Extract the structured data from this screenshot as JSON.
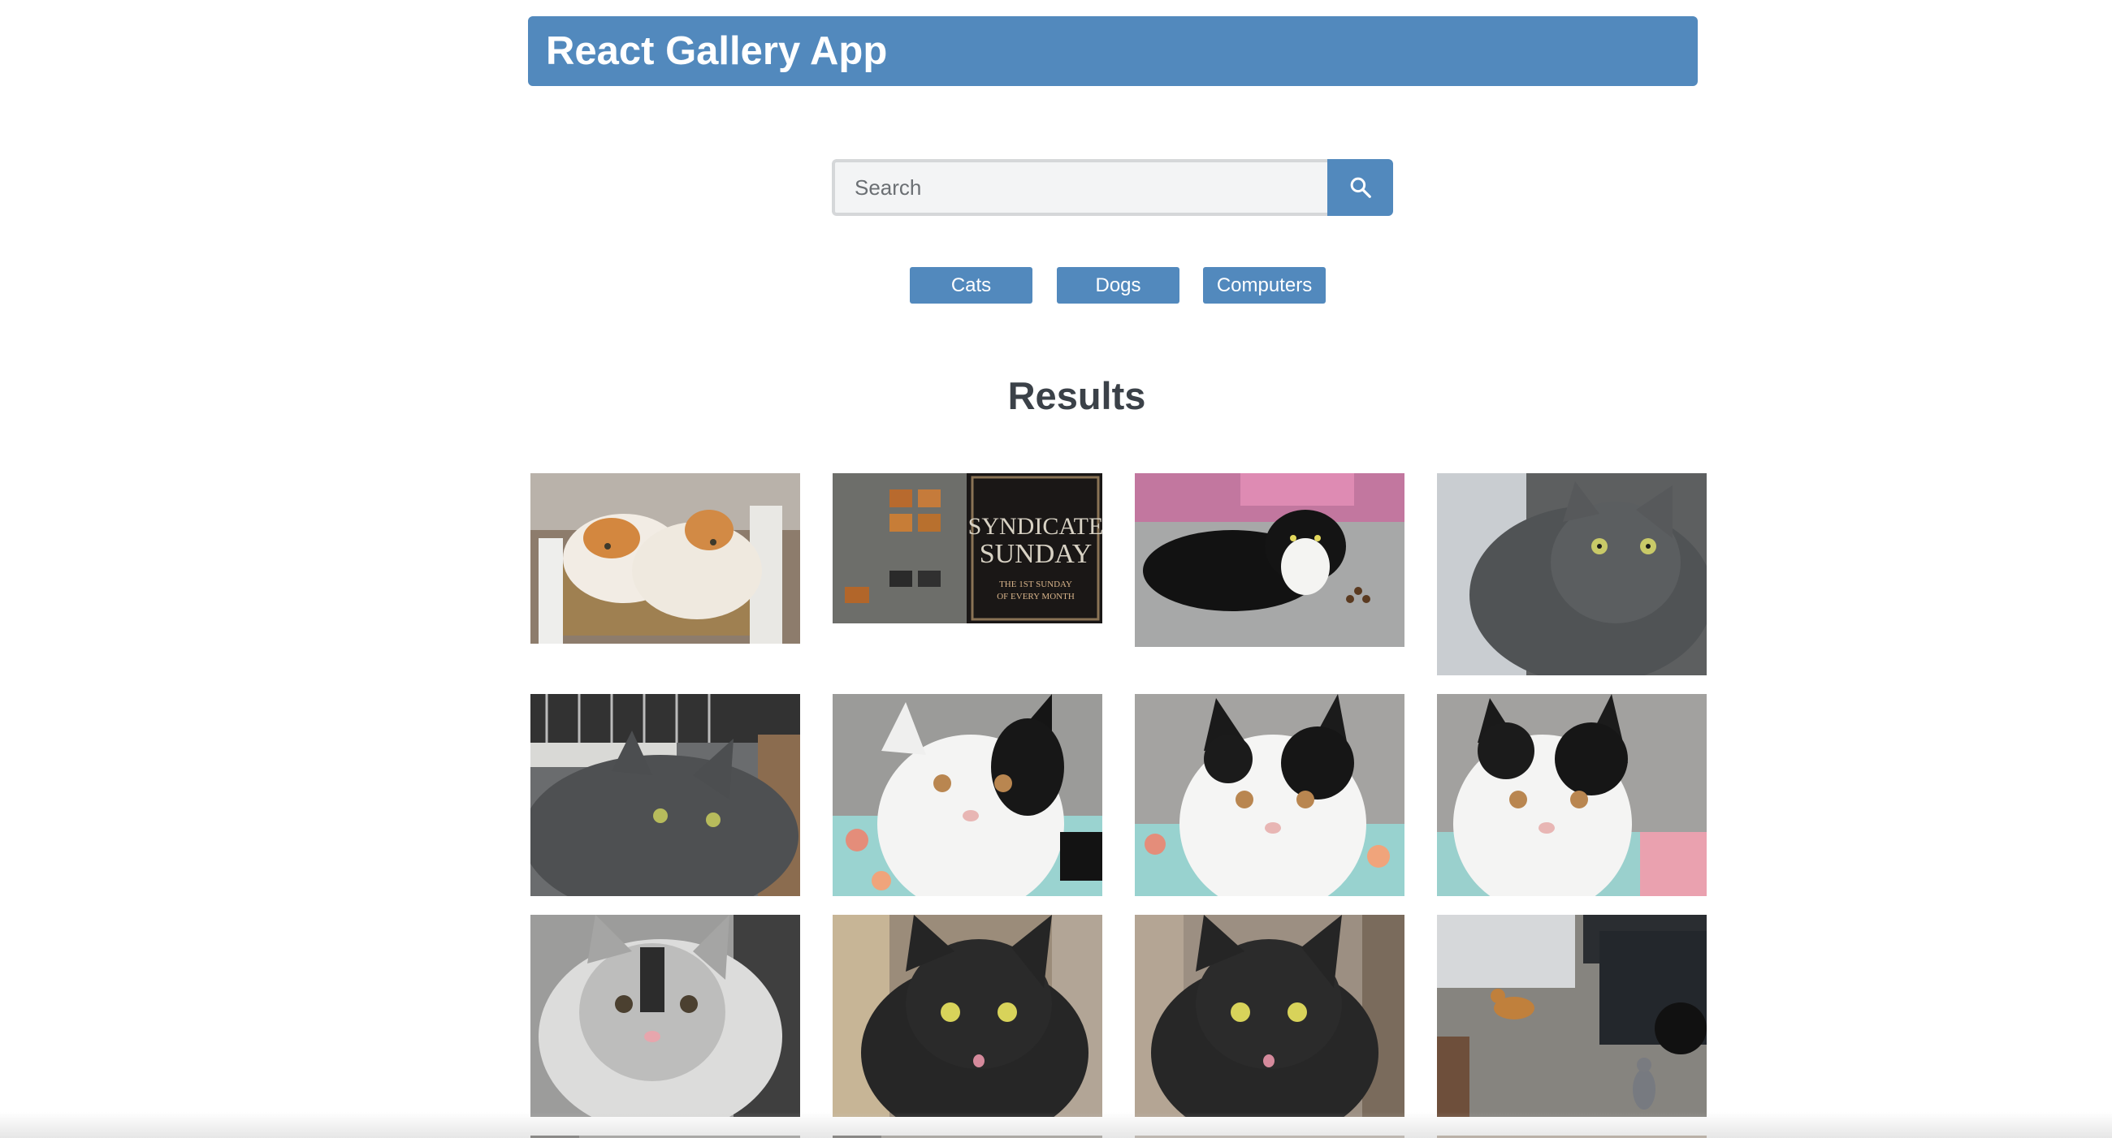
{
  "app": {
    "title": "React Gallery App"
  },
  "search": {
    "placeholder": "Search",
    "value": "",
    "button_icon": "search-icon"
  },
  "nav": {
    "items": [
      {
        "label": "Cats"
      },
      {
        "label": "Dogs"
      },
      {
        "label": "Computers"
      }
    ]
  },
  "results": {
    "heading": "Results"
  },
  "colors": {
    "accent": "#5289bd",
    "heading_text": "#3b4148",
    "input_bg": "#f3f4f5"
  }
}
